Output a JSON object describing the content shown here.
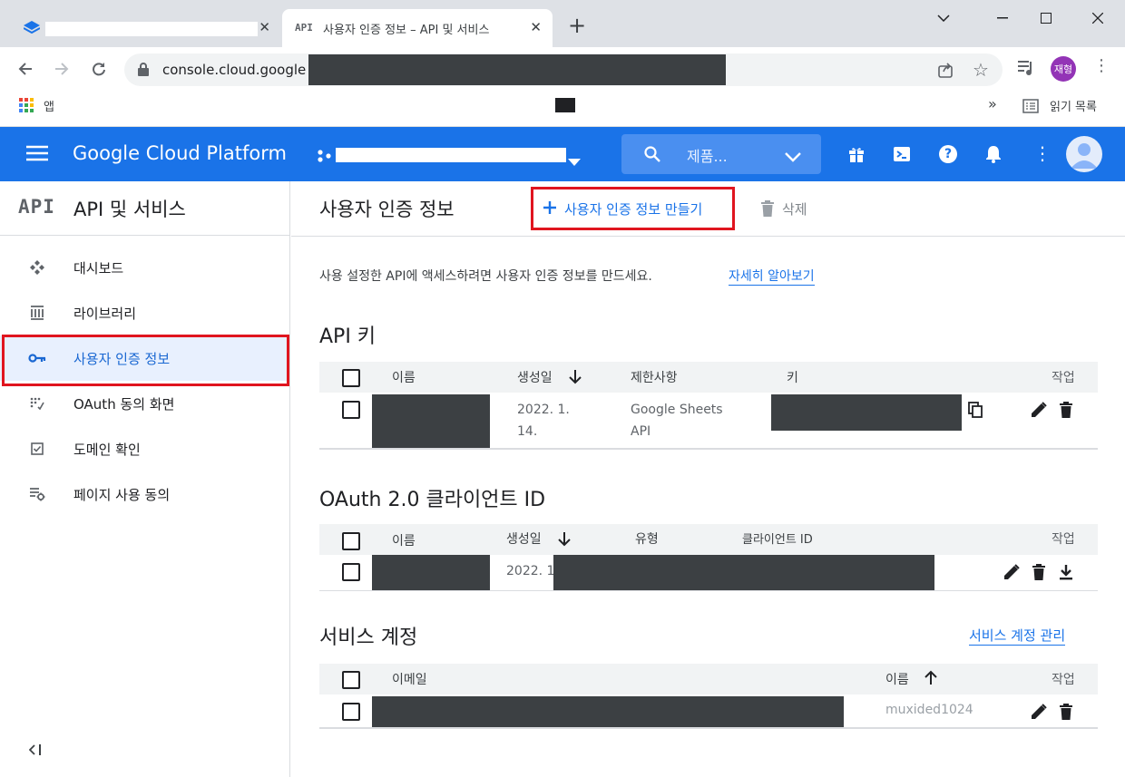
{
  "browser": {
    "tabs": [
      {
        "title": "",
        "favicon": "gcp-favicon"
      },
      {
        "title": "사용자 인증 정보 – API 및 서비스",
        "favicon_text": "API"
      }
    ],
    "new_tab_label": "+",
    "url": "console.cloud.google",
    "profile_name": "재형",
    "bookmarks_apps_label": "앱",
    "bookmarks_overflow": "»",
    "reading_list_label": "읽기 목록"
  },
  "header": {
    "product": "Google Cloud Platform",
    "search_placeholder": "제품..."
  },
  "sidebar": {
    "logo_text": "API",
    "title": "API 및 서비스",
    "items": [
      {
        "label": "대시보드",
        "icon": "dashboard-icon"
      },
      {
        "label": "라이브러리",
        "icon": "library-icon"
      },
      {
        "label": "사용자 인증 정보",
        "icon": "key-icon",
        "active": true
      },
      {
        "label": "OAuth 동의 화면",
        "icon": "oauth-icon"
      },
      {
        "label": "도메인 확인",
        "icon": "checkbox-icon"
      },
      {
        "label": "페이지 사용 동의",
        "icon": "settings-list-icon"
      }
    ],
    "collapse_label": "<|"
  },
  "page": {
    "title": "사용자 인증 정보",
    "create_button": "사용자 인증 정보 만들기",
    "delete_button": "삭제",
    "intro_text": "사용 설정한 API에 액세스하려면 사용자 인증 정보를 만드세요.",
    "learn_more": "자세히 알아보기"
  },
  "api_keys": {
    "title": "API 키",
    "columns": [
      "이름",
      "생성일",
      "제한사항",
      "키",
      "작업"
    ],
    "rows": [
      {
        "created_line1": "2022. 1.",
        "created_line2": "14.",
        "restriction_line1": "Google Sheets",
        "restriction_line2": "API"
      }
    ]
  },
  "oauth": {
    "title": "OAuth 2.0 클라이언트 ID",
    "columns": [
      "이름",
      "생성일",
      "유형",
      "클라이언트 ID",
      "작업"
    ],
    "rows": [
      {
        "created": "2022. 1"
      }
    ]
  },
  "service_accounts": {
    "title": "서비스 계정",
    "manage_link": "서비스 계정 관리",
    "columns": [
      "이메일",
      "이름",
      "작업"
    ],
    "rows": [
      {
        "name": "muxided1024"
      }
    ]
  }
}
